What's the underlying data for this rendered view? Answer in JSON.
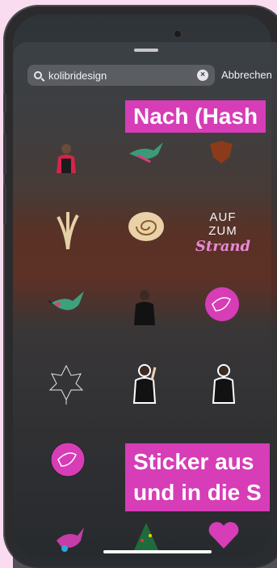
{
  "search": {
    "query": "kolibridesign",
    "clear_icon": "clear-circle-icon",
    "search_icon": "magnifier-icon"
  },
  "cancel_label": "Abbrechen",
  "overlay": {
    "top_label": "Nach (Hash",
    "bottom_label_line1": "Sticker aus",
    "bottom_label_line2": "und in die S"
  },
  "stickers": {
    "aufzum_line1": "AUF ZUM",
    "aufzum_line2": "Strand"
  },
  "colors": {
    "accent": "#d63db7",
    "background": "#f9dcef"
  }
}
